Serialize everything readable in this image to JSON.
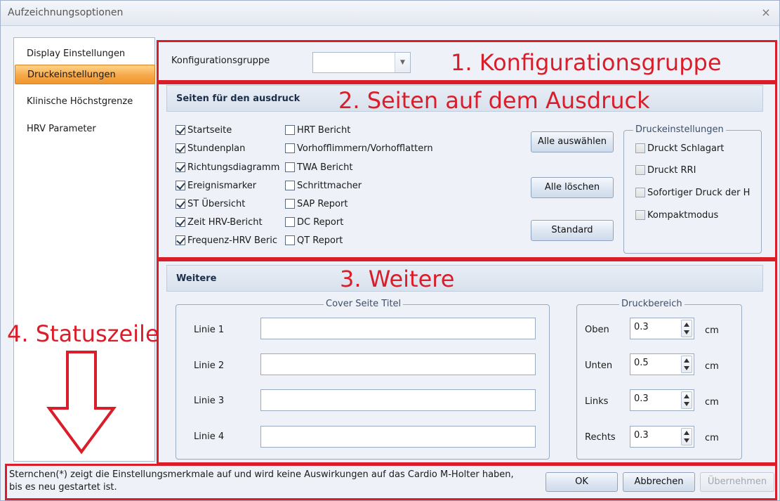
{
  "window": {
    "title": "Aufzeichnungsoptionen",
    "close_glyph": "×"
  },
  "nav": {
    "items": [
      {
        "label": "Display Einstellungen",
        "active": false
      },
      {
        "label": "Druckeinstellungen",
        "active": true
      },
      {
        "label": "Klinische Höchstgrenze",
        "active": false
      },
      {
        "label": "HRV Parameter",
        "active": false
      }
    ]
  },
  "config": {
    "label": "Konfigurationsgruppe",
    "value": "",
    "dropdown_glyph": "▼"
  },
  "pages": {
    "header": "Seiten für den ausdruck",
    "left_items": [
      {
        "label": "Startseite",
        "checked": true
      },
      {
        "label": "Stundenplan",
        "checked": true
      },
      {
        "label": "Richtungsdiagramm",
        "checked": true
      },
      {
        "label": "Ereignismarker",
        "checked": true
      },
      {
        "label": "ST Übersicht",
        "checked": true
      },
      {
        "label": "Zeit HRV-Bericht",
        "checked": true
      },
      {
        "label": "Frequenz-HRV Beric",
        "checked": true
      }
    ],
    "right_items": [
      {
        "label": "HRT Bericht",
        "checked": false
      },
      {
        "label": "Vorhofflimmern/Vorhofflattern",
        "checked": false
      },
      {
        "label": "TWA  Bericht",
        "checked": false
      },
      {
        "label": "Schrittmacher",
        "checked": false
      },
      {
        "label": "SAP Report",
        "checked": false
      },
      {
        "label": "DC Report",
        "checked": false
      },
      {
        "label": "QT Report",
        "checked": false
      }
    ],
    "buttons": {
      "select_all": "Alle auswählen",
      "clear_all": "Alle löschen",
      "default": "Standard"
    }
  },
  "print_settings": {
    "title": "Druckeinstellungen",
    "options": [
      {
        "label": "Druckt Schlagart",
        "checked": false
      },
      {
        "label": "Druckt RRI",
        "checked": false
      },
      {
        "label": "Sofortiger Druck der H",
        "checked": false
      },
      {
        "label": "Kompaktmodus",
        "checked": false
      }
    ]
  },
  "weitere": {
    "header": "Weitere",
    "cover": {
      "title": "Cover Seite Titel",
      "lines": [
        {
          "label": "Linie 1",
          "value": ""
        },
        {
          "label": "Linie 2",
          "value": ""
        },
        {
          "label": "Linie 3",
          "value": ""
        },
        {
          "label": "Linie 4",
          "value": ""
        }
      ]
    },
    "print_area": {
      "title": "Druckbereich",
      "unit": "cm",
      "margins": [
        {
          "label": "Oben",
          "value": "0.3"
        },
        {
          "label": "Unten",
          "value": "0.5"
        },
        {
          "label": "Links",
          "value": "0.3"
        },
        {
          "label": "Rechts",
          "value": "0.3"
        }
      ]
    }
  },
  "status": {
    "text": "Sternchen(*) zeigt die Einstellungsmerkmale auf und wird keine Auswirkungen auf das Cardio M-Holter haben, bis es neu gestartet ist."
  },
  "footer_buttons": {
    "ok": "OK",
    "cancel": "Abbrechen",
    "apply": "Übernehmen"
  },
  "annotations": {
    "a1": "1. Konfigurationsgruppe",
    "a2": "2. Seiten auf dem Ausdruck",
    "a3": "3. Weitere",
    "a4": "4. Statuszeile",
    "color": "#d91e2a"
  }
}
